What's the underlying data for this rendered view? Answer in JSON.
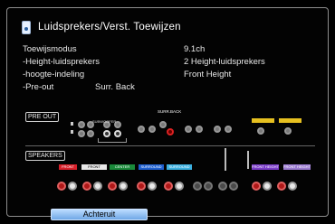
{
  "title": "Luidsprekers/Verst. Toewijzen",
  "settings": [
    {
      "label": "Toewijsmodus",
      "value": "9.1ch"
    },
    {
      "label": "-Height-luidsprekers",
      "value": "2 Height-luidsprekers"
    },
    {
      "label": "-hoogte-indeling",
      "value": "Front Height"
    },
    {
      "label": "-Pre-out",
      "value": "Surr. Back"
    }
  ],
  "diagram": {
    "pre_out_label": "PRE OUT",
    "speakers_label": "SPEAKERS",
    "subwoofer_label": "SUBWOOFER",
    "surr_back_label": "SURR.BACK",
    "group_labels": [
      "FRONT",
      "FRONT",
      "CENTER",
      "SURROUND",
      "SURROUND",
      "FRONT HEIGHT",
      "FRONT HEIGHT"
    ],
    "colors": {
      "front_l": "#d8202a",
      "front_r": "#e8e8e8",
      "center": "#1a8a3a",
      "surround_l": "#1e5fd0",
      "surround_r": "#3bb0e0",
      "height_l": "#7a3cc8",
      "height_r": "#9a7ad0",
      "pre_height": "#e6c020"
    }
  },
  "back_button": "Achteruit"
}
